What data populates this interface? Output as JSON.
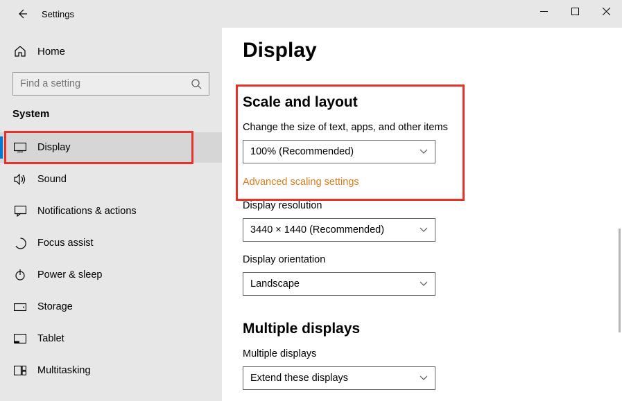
{
  "window": {
    "title": "Settings"
  },
  "sidebar": {
    "home": "Home",
    "search_placeholder": "Find a setting",
    "category": "System",
    "items": [
      {
        "label": "Display"
      },
      {
        "label": "Sound"
      },
      {
        "label": "Notifications & actions"
      },
      {
        "label": "Focus assist"
      },
      {
        "label": "Power & sleep"
      },
      {
        "label": "Storage"
      },
      {
        "label": "Tablet"
      },
      {
        "label": "Multitasking"
      }
    ]
  },
  "page": {
    "heading": "Display",
    "sections": {
      "scale": {
        "title": "Scale and layout",
        "size_label": "Change the size of text, apps, and other items",
        "size_value": "100% (Recommended)",
        "advanced_link": "Advanced scaling settings",
        "resolution_label": "Display resolution",
        "resolution_value": "3440 × 1440 (Recommended)",
        "orientation_label": "Display orientation",
        "orientation_value": "Landscape"
      },
      "multiple": {
        "title": "Multiple displays",
        "label": "Multiple displays",
        "value": "Extend these displays"
      }
    }
  }
}
